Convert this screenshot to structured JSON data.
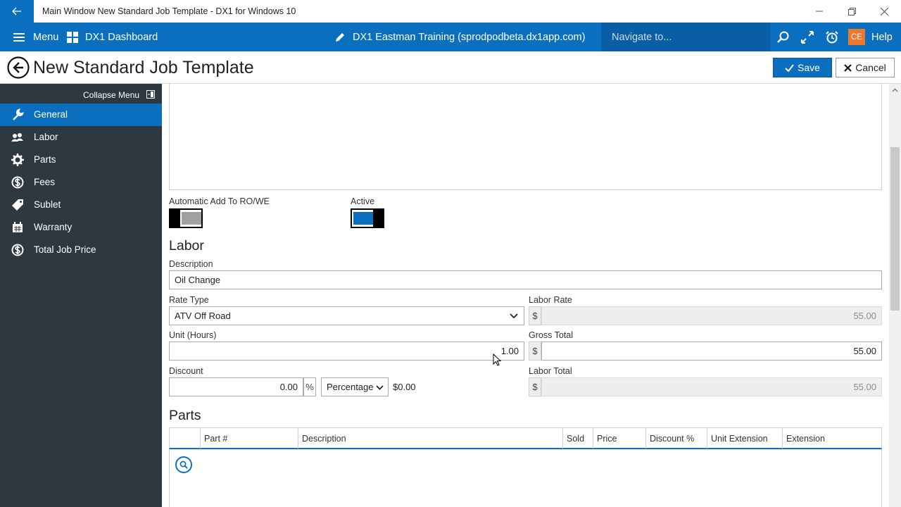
{
  "window": {
    "title": "Main Window New Standard Job Template - DX1 for Windows 10"
  },
  "appbar": {
    "menu_label": "Menu",
    "dashboard_label": "DX1 Dashboard",
    "env_label": "DX1 Eastman Training (sprodpodbeta.dx1app.com)",
    "navigate_placeholder": "Navigate to...",
    "user_initials": "CE",
    "help_label": "Help"
  },
  "header": {
    "title": "New Standard Job Template",
    "save_label": "Save",
    "cancel_label": "Cancel"
  },
  "sidebar": {
    "collapse_label": "Collapse Menu",
    "items": [
      {
        "label": "General",
        "icon": "wrench-icon",
        "active": true
      },
      {
        "label": "Labor",
        "icon": "people-icon",
        "active": false
      },
      {
        "label": "Parts",
        "icon": "gear-icon",
        "active": false
      },
      {
        "label": "Fees",
        "icon": "dollar-circle-icon",
        "active": false
      },
      {
        "label": "Sublet",
        "icon": "tag-icon",
        "active": false
      },
      {
        "label": "Warranty",
        "icon": "calendar-icon",
        "active": false
      },
      {
        "label": "Total Job Price",
        "icon": "dollar-circle-icon",
        "active": false
      }
    ]
  },
  "general": {
    "auto_add_label": "Automatic Add To RO/WE",
    "auto_add_value": false,
    "active_label": "Active",
    "active_value": true
  },
  "labor": {
    "section_title": "Labor",
    "description_label": "Description",
    "description_value": "Oil Change",
    "rate_type_label": "Rate Type",
    "rate_type_value": "ATV Off Road",
    "labor_rate_label": "Labor Rate",
    "labor_rate_value": "55.00",
    "unit_label": "Unit (Hours)",
    "unit_value": "1.00",
    "gross_total_label": "Gross Total",
    "gross_total_value": "55.00",
    "discount_label": "Discount",
    "discount_value": "0.00",
    "discount_unit": "%",
    "discount_type": "Percentage",
    "discount_amount": "$0.00",
    "labor_total_label": "Labor Total",
    "labor_total_value": "55.00",
    "currency_symbol": "$"
  },
  "parts": {
    "section_title": "Parts",
    "columns": [
      "Part #",
      "Description",
      "Sold",
      "Price",
      "Discount %",
      "Unit Extension",
      "Extension"
    ]
  },
  "colors": {
    "accent": "#0b6fc0",
    "sidebar_bg": "#2e3841",
    "user_badge": "#f0762c"
  }
}
